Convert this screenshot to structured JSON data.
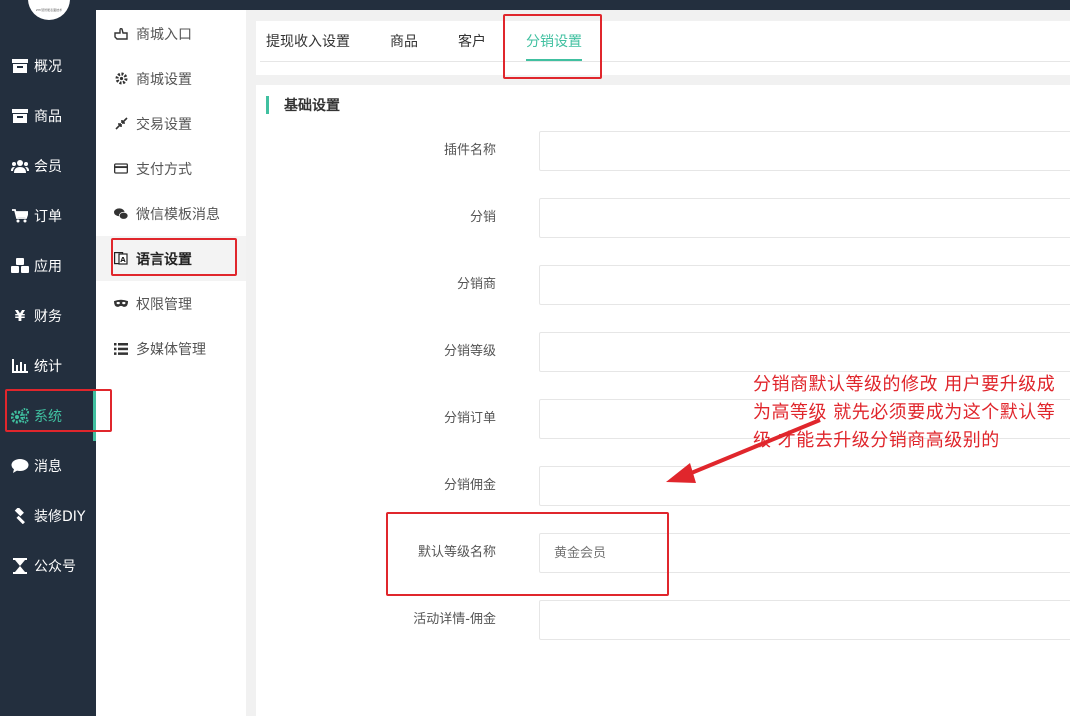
{
  "logo": {
    "caption": "ZHI慧智能表面技术"
  },
  "sidebar": {
    "items": [
      {
        "label": "概况",
        "icon": "archive-icon"
      },
      {
        "label": "商品",
        "icon": "archive-icon"
      },
      {
        "label": "会员",
        "icon": "users-icon"
      },
      {
        "label": "订单",
        "icon": "cart-icon"
      },
      {
        "label": "应用",
        "icon": "cubes-icon"
      },
      {
        "label": "财务",
        "icon": "yen-icon"
      },
      {
        "label": "统计",
        "icon": "bar-chart-icon"
      },
      {
        "label": "系统",
        "icon": "gears-icon",
        "active": true
      },
      {
        "label": "消息",
        "icon": "comment-icon"
      },
      {
        "label": "装修DIY",
        "icon": "gavel-icon"
      },
      {
        "label": "公众号",
        "icon": "hourglass-icon"
      }
    ]
  },
  "submenu": {
    "items": [
      {
        "label": "商城入口",
        "icon": "hand-pointer-icon"
      },
      {
        "label": "商城设置",
        "icon": "gear-icon"
      },
      {
        "label": "交易设置",
        "icon": "compress-arrows-icon"
      },
      {
        "label": "支付方式",
        "icon": "credit-card-icon"
      },
      {
        "label": "微信模板消息",
        "icon": "wechat-icon"
      },
      {
        "label": "语言设置",
        "icon": "translate-icon",
        "active": true
      },
      {
        "label": "权限管理",
        "icon": "mask-icon"
      },
      {
        "label": "多媒体管理",
        "icon": "list-icon"
      }
    ]
  },
  "tabs": [
    {
      "label": "提现收入设置"
    },
    {
      "label": "商品"
    },
    {
      "label": "客户"
    },
    {
      "label": "分销设置",
      "active": true
    }
  ],
  "form": {
    "section_title": "基础设置",
    "fields": [
      {
        "label": "插件名称",
        "value": ""
      },
      {
        "label": "分销",
        "value": ""
      },
      {
        "label": "分销商",
        "value": ""
      },
      {
        "label": "分销等级",
        "value": ""
      },
      {
        "label": "分销订单",
        "value": ""
      },
      {
        "label": "分销佣金",
        "value": ""
      },
      {
        "label": "默认等级名称",
        "value": "",
        "placeholder": "黄金会员"
      },
      {
        "label": "活动详情-佣金",
        "value": ""
      }
    ]
  },
  "annotation": {
    "note": "分销商默认等级的修改  用户要升级成为高等级 就先必须要成为这个默认等级 才能去升级分销商高级别的",
    "color": "#e0262c"
  },
  "colors": {
    "accent": "#40c0a0",
    "sidebar_bg": "#232f3e"
  }
}
